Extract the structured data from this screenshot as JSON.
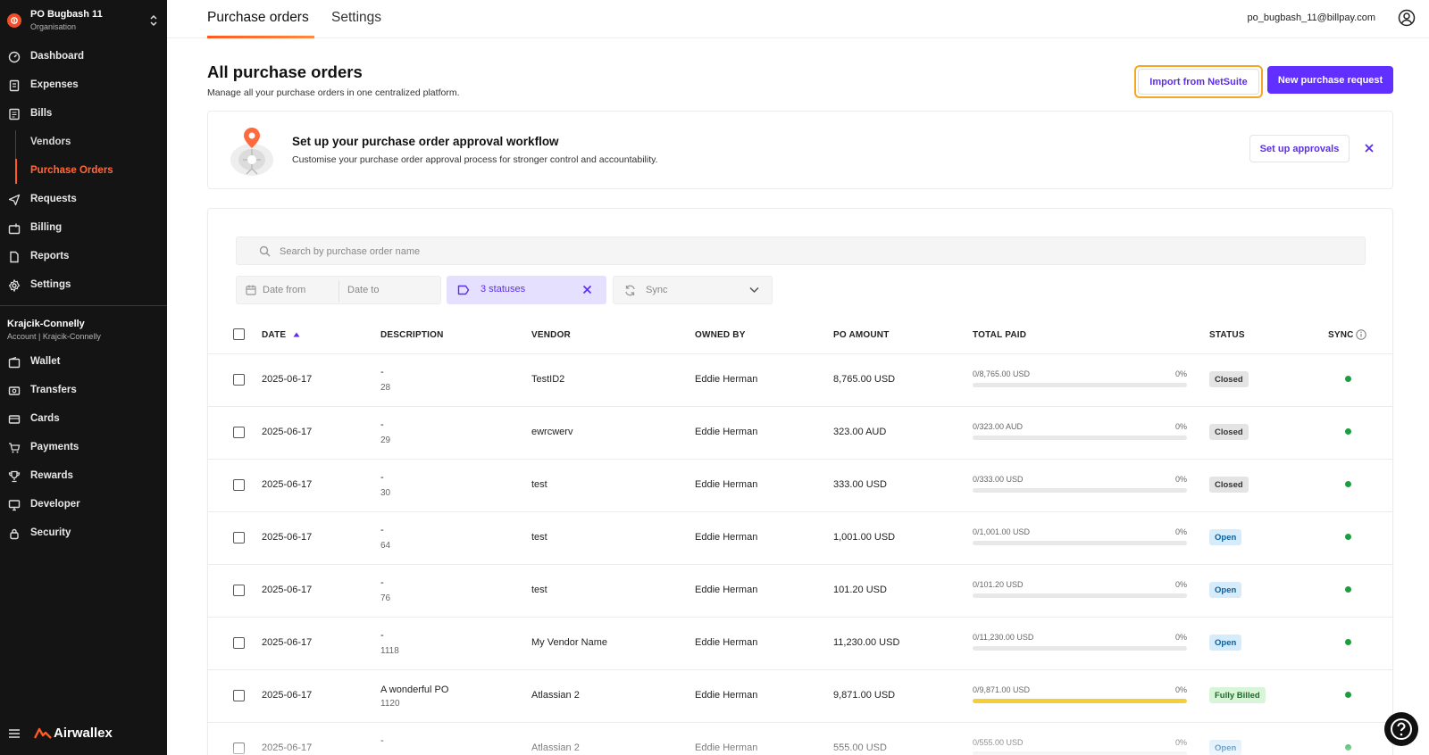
{
  "org": {
    "name": "PO Bugbash 11",
    "subtitle": "Organisation"
  },
  "nav": {
    "main": [
      {
        "label": "Dashboard",
        "icon": "dashboard-icon"
      },
      {
        "label": "Expenses",
        "icon": "receipt-icon"
      },
      {
        "label": "Bills",
        "icon": "bill-icon"
      },
      {
        "label": "Vendors",
        "icon": ""
      },
      {
        "label": "Purchase Orders",
        "icon": ""
      },
      {
        "label": "Requests",
        "icon": "send-icon"
      },
      {
        "label": "Billing",
        "icon": "billing-icon"
      },
      {
        "label": "Reports",
        "icon": "report-icon"
      },
      {
        "label": "Settings",
        "icon": "gear-icon"
      }
    ],
    "account": {
      "name": "Krajcik-Connelly",
      "subtitle": "Account | Krajcik-Connelly"
    },
    "account_items": [
      {
        "label": "Wallet",
        "icon": "wallet-icon"
      },
      {
        "label": "Transfers",
        "icon": "transfer-icon"
      },
      {
        "label": "Cards",
        "icon": "card-icon"
      },
      {
        "label": "Payments",
        "icon": "cart-icon"
      },
      {
        "label": "Rewards",
        "icon": "trophy-icon"
      },
      {
        "label": "Developer",
        "icon": "monitor-icon"
      },
      {
        "label": "Security",
        "icon": "lock-icon"
      }
    ],
    "brand": "Airwallex"
  },
  "header": {
    "tabs": [
      "Purchase orders",
      "Settings"
    ],
    "user_email": "po_bugbash_11@billpay.com"
  },
  "page": {
    "title": "All purchase orders",
    "subtitle": "Manage all your purchase orders in one centralized platform.",
    "import_button": "Import from NetSuite",
    "new_button": "New purchase request"
  },
  "banner": {
    "title": "Set up your purchase order approval workflow",
    "subtitle": "Customise your purchase order approval process for stronger control and accountability.",
    "button": "Set up approvals"
  },
  "filters": {
    "search_placeholder": "Search by purchase order name",
    "date_from": "Date from",
    "date_to": "Date to",
    "status": "3 statuses",
    "sync": "Sync"
  },
  "table": {
    "headers": [
      "DATE",
      "DESCRIPTION",
      "VENDOR",
      "OWNED BY",
      "PO AMOUNT",
      "TOTAL PAID",
      "STATUS",
      "SYNC"
    ],
    "rows": [
      {
        "date": "2025-06-17",
        "desc": "-",
        "num": "28",
        "vendor": "TestID2",
        "owner": "Eddie Herman",
        "amount": "8,765.00 USD",
        "paid": "0/8,765.00 USD",
        "pct": "0%",
        "fill": 0,
        "status": "Closed",
        "status_type": "closed"
      },
      {
        "date": "2025-06-17",
        "desc": "-",
        "num": "29",
        "vendor": "ewrcwerv",
        "owner": "Eddie Herman",
        "amount": "323.00 AUD",
        "paid": "0/323.00 AUD",
        "pct": "0%",
        "fill": 0,
        "status": "Closed",
        "status_type": "closed"
      },
      {
        "date": "2025-06-17",
        "desc": "-",
        "num": "30",
        "vendor": "test",
        "owner": "Eddie Herman",
        "amount": "333.00 USD",
        "paid": "0/333.00 USD",
        "pct": "0%",
        "fill": 0,
        "status": "Closed",
        "status_type": "closed"
      },
      {
        "date": "2025-06-17",
        "desc": "-",
        "num": "64",
        "vendor": "test",
        "owner": "Eddie Herman",
        "amount": "1,001.00 USD",
        "paid": "0/1,001.00 USD",
        "pct": "0%",
        "fill": 0,
        "status": "Open",
        "status_type": "open"
      },
      {
        "date": "2025-06-17",
        "desc": "-",
        "num": "76",
        "vendor": "test",
        "owner": "Eddie Herman",
        "amount": "101.20 USD",
        "paid": "0/101.20 USD",
        "pct": "0%",
        "fill": 0,
        "status": "Open",
        "status_type": "open"
      },
      {
        "date": "2025-06-17",
        "desc": "-",
        "num": "1118",
        "vendor": "My Vendor Name",
        "owner": "Eddie Herman",
        "amount": "11,230.00 USD",
        "paid": "0/11,230.00 USD",
        "pct": "0%",
        "fill": 0,
        "status": "Open",
        "status_type": "open"
      },
      {
        "date": "2025-06-17",
        "desc": "A wonderful PO",
        "num": "1120",
        "vendor": "Atlassian 2",
        "owner": "Eddie Herman",
        "amount": "9,871.00 USD",
        "paid": "0/9,871.00 USD",
        "pct": "0%",
        "fill": 1,
        "status": "Fully Billed",
        "status_type": "billed"
      },
      {
        "date": "2025-06-17",
        "desc": "-",
        "num": "",
        "vendor": "Atlassian 2",
        "owner": "Eddie Herman",
        "amount": "555.00 USD",
        "paid": "0/555.00 USD",
        "pct": "0%",
        "fill": 0,
        "status": "Open",
        "status_type": "open"
      }
    ]
  },
  "colors": {
    "accent": "#612fff",
    "brand_orange": "#ff5a1f",
    "sync_green": "#1a9e3f",
    "billed_bar": "#f5cf3a"
  }
}
